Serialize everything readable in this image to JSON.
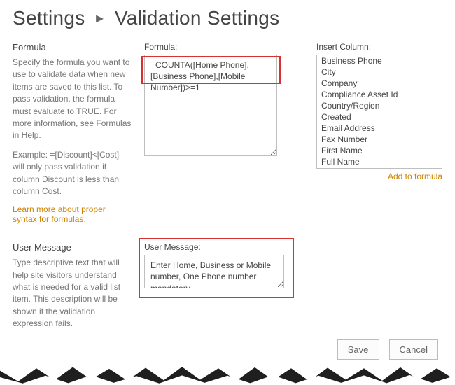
{
  "breadcrumb": {
    "root": "Settings",
    "sep": "►",
    "current": "Validation Settings"
  },
  "formula_section": {
    "heading": "Formula",
    "description": "Specify the formula you want to use to validate data when new items are saved to this list. To pass validation, the formula must evaluate to TRUE. For more information, see Formulas in Help.",
    "example": "Example: =[Discount]<[Cost] will only pass validation if column Discount is less than column Cost.",
    "learn_more": "Learn more about proper syntax for formulas.",
    "field_label": "Formula:",
    "value": "=COUNTA([Home Phone],[Business Phone],[Mobile Number])>=1"
  },
  "insert_column": {
    "label": "Insert Column:",
    "items": [
      "Business Phone",
      "City",
      "Company",
      "Compliance Asset Id",
      "Country/Region",
      "Created",
      "Email Address",
      "Fax Number",
      "First Name",
      "Full Name"
    ],
    "add_link": "Add to formula"
  },
  "user_message_section": {
    "heading": "User Message",
    "description": "Type descriptive text that will help site visitors understand what is needed for a valid list item. This description will be shown if the validation expression fails.",
    "field_label": "User Message:",
    "value": "Enter Home, Business or Mobile number, One Phone number mandatory"
  },
  "buttons": {
    "save": "Save",
    "cancel": "Cancel"
  }
}
